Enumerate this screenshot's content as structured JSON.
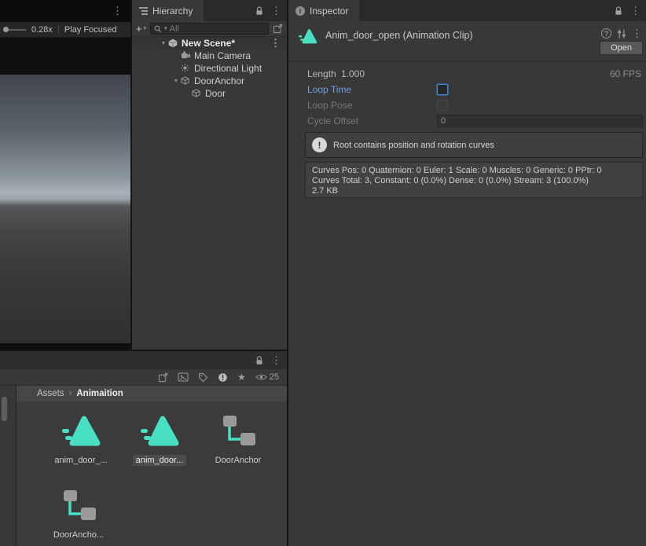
{
  "colors": {
    "accent_teal": "#49dfc3",
    "loop_label_blue": "#6ca1df",
    "panel_bg": "#383838"
  },
  "icons": {
    "kebab": "⋮",
    "foldout_open": "▼",
    "caret_down": "▾",
    "star": "★",
    "help": "?",
    "info_i": "i",
    "plus": "+",
    "exclaim": "!"
  },
  "game_view": {
    "scale_value": "0.28x",
    "focus_mode": "Play Focused"
  },
  "hierarchy": {
    "tab_label": "Hierarchy",
    "search_filter": "All",
    "scene_row": "New Scene*",
    "items": [
      {
        "label": "Main Camera"
      },
      {
        "label": "Directional Light"
      },
      {
        "label": "DoorAnchor"
      },
      {
        "label": "Door"
      }
    ]
  },
  "inspector": {
    "tab_label": "Inspector",
    "header_title": "Anim_door_open (Animation Clip)",
    "open_button": "Open",
    "length_label": "Length",
    "length_value": "1.000",
    "fps_value": "60 FPS",
    "loop_time_label": "Loop Time",
    "loop_time_checked": false,
    "loop_pose_label": "Loop Pose",
    "loop_pose_checked": false,
    "cycle_offset_label": "Cycle Offset",
    "cycle_offset_value": "0",
    "warning_text": "Root contains position and rotation curves",
    "stats": {
      "line1": "Curves Pos: 0 Quaternion: 0 Euler: 1 Scale: 0 Muscles: 0 Generic: 0 PPtr: 0",
      "line2": "Curves Total: 3, Constant: 0 (0.0%) Dense: 0 (0.0%) Stream: 3 (100.0%)",
      "line3": "2.7 KB"
    }
  },
  "project": {
    "hidden_packages_count": "25",
    "breadcrumb": {
      "root": "Assets",
      "separator": "›",
      "current": "Animaition"
    },
    "items": [
      {
        "label": "anim_door_...",
        "type": "animation-clip",
        "selected": false
      },
      {
        "label": "anim_door...",
        "type": "animation-clip",
        "selected": true
      },
      {
        "label": "DoorAnchor",
        "type": "animator-controller",
        "selected": false
      },
      {
        "label": "DoorAncho...",
        "type": "animator-controller",
        "selected": false
      }
    ]
  }
}
